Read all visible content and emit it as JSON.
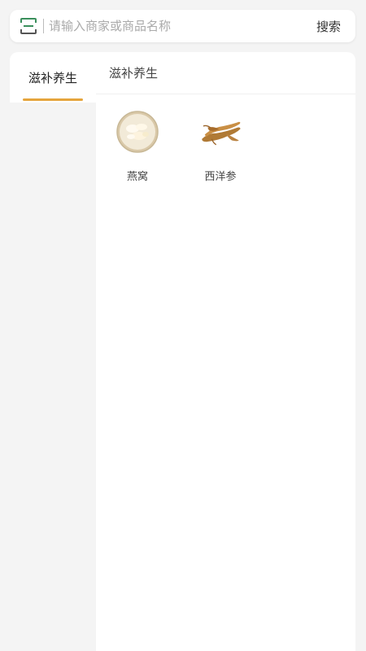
{
  "search": {
    "placeholder": "请输入商家或商品名称",
    "button_label": "搜索"
  },
  "sidebar": {
    "items": [
      {
        "label": "滋补养生",
        "active": true
      }
    ],
    "accent_color": "#e5a53d"
  },
  "content": {
    "header": "滋补养生",
    "products": [
      {
        "name": "燕窝",
        "icon": "birds-nest-image"
      },
      {
        "name": "西洋参",
        "icon": "ginseng-image"
      }
    ]
  }
}
